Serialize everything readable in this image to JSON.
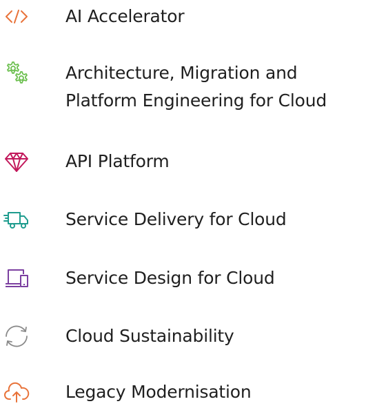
{
  "services": [
    {
      "label_lines": [
        "AI Accelerator"
      ],
      "icon": "code-brackets-icon",
      "color": "#E8733A"
    },
    {
      "label_lines": [
        "Architecture, Migration and",
        "Platform Engineering for Cloud"
      ],
      "icon": "gears-icon",
      "color": "#6BBF4E"
    },
    {
      "label_lines": [
        "API Platform"
      ],
      "icon": "diamond-icon",
      "color": "#C2185B"
    },
    {
      "label_lines": [
        "Service Delivery for Cloud"
      ],
      "icon": "delivery-truck-icon",
      "color": "#1E9C8E"
    },
    {
      "label_lines": [
        "Service Design for Cloud"
      ],
      "icon": "devices-icon",
      "color": "#7B3FA0"
    },
    {
      "label_lines": [
        "Cloud Sustainability"
      ],
      "icon": "refresh-cycle-icon",
      "color": "#8A8A8A"
    },
    {
      "label_lines": [
        "Legacy Modernisation"
      ],
      "icon": "cloud-upload-icon",
      "color": "#E8733A"
    }
  ]
}
